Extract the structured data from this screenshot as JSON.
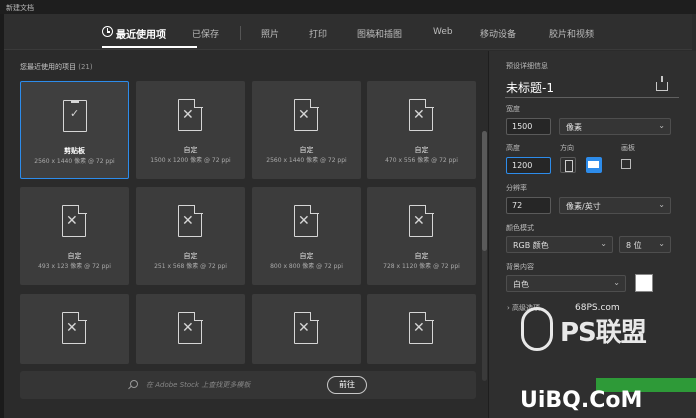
{
  "window": {
    "title": "新建文档"
  },
  "tabs": [
    {
      "label": "最近使用项",
      "active": true
    },
    {
      "label": "已保存"
    },
    {
      "label": "照片"
    },
    {
      "label": "打印"
    },
    {
      "label": "图稿和插图"
    },
    {
      "label": "Web"
    },
    {
      "label": "移动设备"
    },
    {
      "label": "胶片和视频"
    }
  ],
  "recent": {
    "title": "您最近使用的项目",
    "count": "(21)",
    "cards": [
      {
        "name": "剪贴板",
        "dims": "2560 x 1440 像素 @ 72 ppi",
        "selected": true
      },
      {
        "name": "自定",
        "dims": "1500 x 1200 像素 @ 72 ppi"
      },
      {
        "name": "自定",
        "dims": "2560 x 1440 像素 @ 72 ppi"
      },
      {
        "name": "自定",
        "dims": "470 x 556 像素 @ 72 ppi"
      },
      {
        "name": "自定",
        "dims": "493 x 123 像素 @ 72 ppi"
      },
      {
        "name": "自定",
        "dims": "251 x 568 像素 @ 72 ppi"
      },
      {
        "name": "自定",
        "dims": "800 x 800 像素 @ 72 ppi"
      },
      {
        "name": "自定",
        "dims": "728 x 1120 像素 @ 72 ppi"
      },
      {
        "name": "",
        "dims": ""
      },
      {
        "name": "",
        "dims": ""
      },
      {
        "name": "",
        "dims": ""
      },
      {
        "name": "",
        "dims": ""
      }
    ]
  },
  "stock": {
    "placeholder": "在 Adobe Stock 上查找更多模板",
    "go_label": "前往"
  },
  "preset": {
    "section_label": "预设详细信息",
    "name": "未标题-1",
    "width_label": "宽度",
    "width_value": "1500",
    "width_unit": "像素",
    "height_label": "高度",
    "height_value": "1200",
    "orientation_label": "方向",
    "artboard_label": "画板",
    "resolution_label": "分辨率",
    "resolution_value": "72",
    "resolution_unit": "像素/英寸",
    "color_mode_label": "颜色模式",
    "color_mode_value": "RGB 颜色",
    "bit_depth_value": "8 位",
    "background_label": "背景内容",
    "background_value": "白色",
    "advanced_label": "高级选项"
  },
  "watermark": {
    "site": "68PS.com",
    "brand": "PS联盟",
    "bottom": "UiBQ.CoM"
  },
  "colors": {
    "accent": "#2d8ceb",
    "panel": "#2b2b2b"
  }
}
